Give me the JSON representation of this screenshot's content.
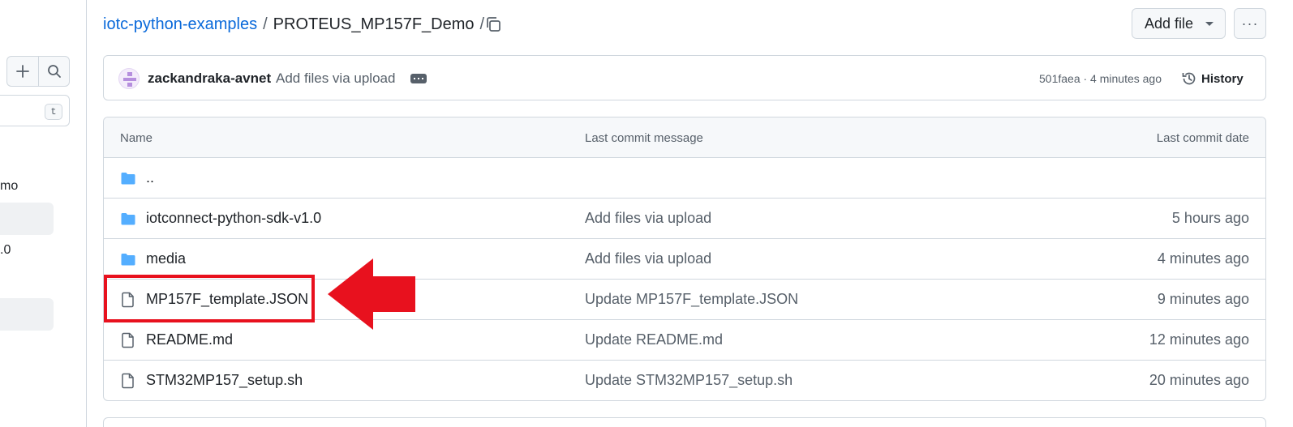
{
  "sidebar": {
    "filter_shortcut": "t",
    "items": [
      {
        "label": "mo"
      },
      {
        "label": ".0"
      }
    ]
  },
  "breadcrumb": {
    "repo": "iotc-python-examples",
    "separator": "/",
    "current": "PROTEUS_MP157F_Demo",
    "trailing": "/"
  },
  "toolbar": {
    "add_file_label": "Add file",
    "more_label": "···"
  },
  "commit": {
    "author": "zackandraka-avnet",
    "message": "Add files via upload",
    "hash_time": "501faea · 4 minutes ago",
    "history_label": "History"
  },
  "table": {
    "headers": {
      "name": "Name",
      "message": "Last commit message",
      "date": "Last commit date"
    },
    "rows": [
      {
        "type": "folder",
        "name": "..",
        "message": "",
        "date": ""
      },
      {
        "type": "folder",
        "name": "iotconnect-python-sdk-v1.0",
        "message": "Add files via upload",
        "date": "5 hours ago"
      },
      {
        "type": "folder",
        "name": "media",
        "message": "Add files via upload",
        "date": "4 minutes ago"
      },
      {
        "type": "file",
        "name": "MP157F_template.JSON",
        "message": "Update MP157F_template.JSON",
        "date": "9 minutes ago"
      },
      {
        "type": "file",
        "name": "README.md",
        "message": "Update README.md",
        "date": "12 minutes ago"
      },
      {
        "type": "file",
        "name": "STM32MP157_setup.sh",
        "message": "Update STM32MP157_setup.sh",
        "date": "20 minutes ago"
      }
    ]
  },
  "colors": {
    "link": "#0969da",
    "folder": "#54aeff",
    "annotation": "#e8111e"
  }
}
